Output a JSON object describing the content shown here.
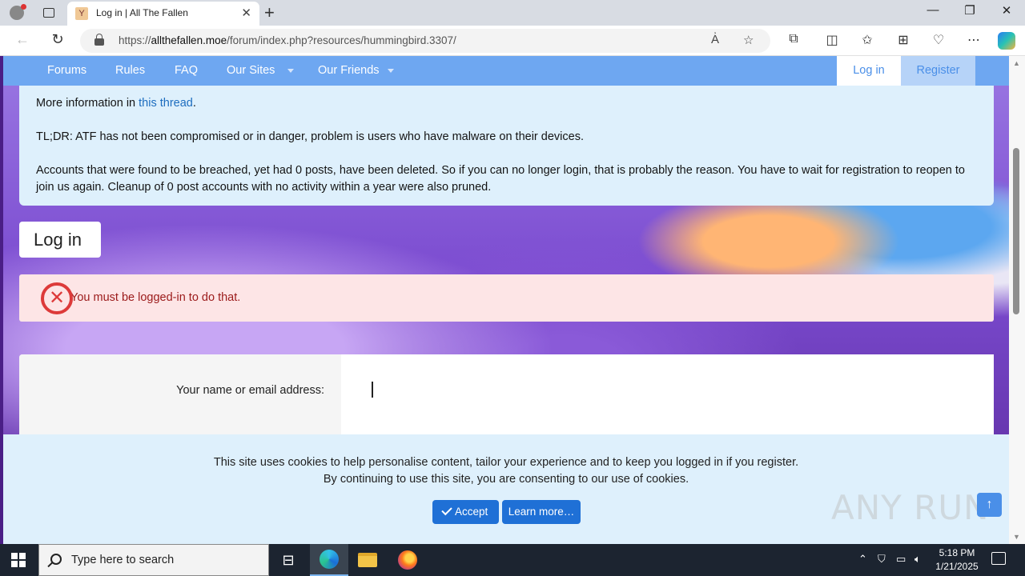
{
  "browser": {
    "tab_title": "Log in | All The Fallen",
    "url_prefix": "https://",
    "url_host": "allthefallen.moe",
    "url_path": "/forum/index.php?resources/hummingbird.3307/",
    "icons": [
      "profile-icon",
      "tab-actions-icon",
      "favicon",
      "close-icon",
      "new-tab-icon",
      "minimize-icon",
      "restore-icon",
      "close-window-icon",
      "back-icon",
      "refresh-icon",
      "lock-icon",
      "read-aloud-icon",
      "favorite-star-icon",
      "extensions-icon",
      "split-screen-icon",
      "favorites-icon",
      "collections-icon",
      "performance-icon",
      "more-icon",
      "copilot-icon"
    ]
  },
  "site_nav": {
    "items": [
      {
        "label": "Forums"
      },
      {
        "label": "Rules"
      },
      {
        "label": "FAQ"
      },
      {
        "label": "Our Sites"
      },
      {
        "label": "Our Friends"
      }
    ],
    "login_label": "Log in",
    "register_label": "Register",
    "accent_color": "#6ea7f1"
  },
  "notice": {
    "line1_prefix": "More information in ",
    "line1_link": "this thread",
    "line1_suffix": ".",
    "line2": "TL;DR: ATF has not been compromised or in danger, problem is users who have malware on their devices.",
    "line3": "Accounts that were found to be breached, yet had 0 posts, have been deleted. So if you can no longer login, that is probably the reason. You have to wait for registration to reopen to join us again. Cleanup of 0 post accounts with no activity within a year were also pruned."
  },
  "page": {
    "title": "Log in",
    "error_message": "You must be logged-in to do that.",
    "error_color": "#dd3a3a",
    "form_label": "Your name or email address:",
    "form_value": ""
  },
  "cookie_notice": {
    "line1": "This site uses cookies to help personalise content, tailor your experience and to keep you logged in if you register.",
    "line2": "By continuing to use this site, you are consenting to our use of cookies.",
    "accept_label": "Accept",
    "learn_more_label": "Learn more…"
  },
  "watermark": "ANY RUN",
  "taskbar": {
    "search_placeholder": "Type here to search",
    "time": "5:18 PM",
    "date": "1/21/2025"
  }
}
